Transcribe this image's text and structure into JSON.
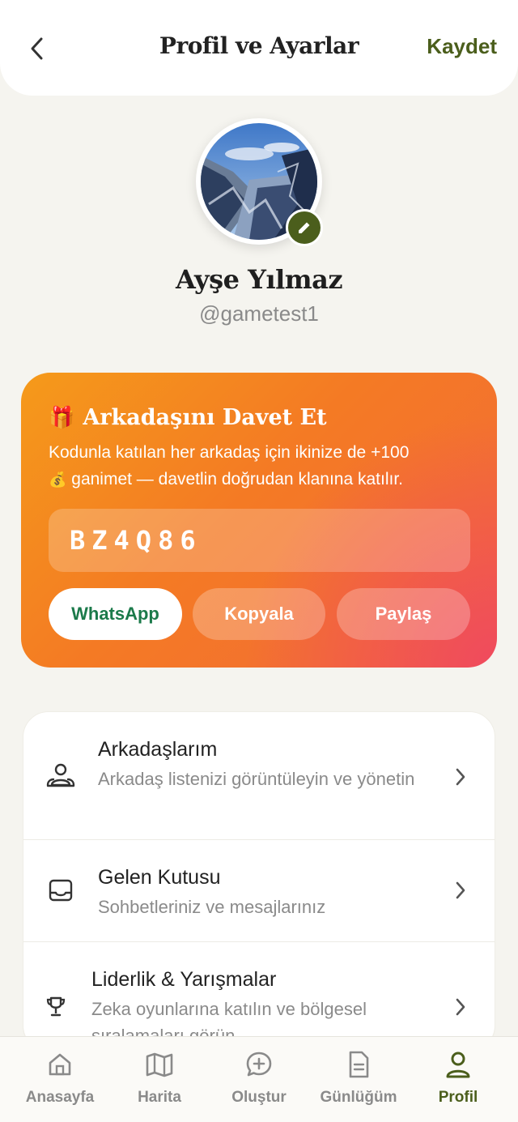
{
  "header": {
    "title": "Profil ve Ayarlar",
    "save_label": "Kaydet",
    "back_icon": "chevron-left-icon"
  },
  "profile": {
    "name": "Ayşe Yılmaz",
    "handle": "@gametest1",
    "edit_icon": "pencil-icon"
  },
  "invite": {
    "gift_icon": "🎁",
    "title": "Arkadaşını Davet Et",
    "description_line1": "Kodunla katılan her arkadaş için ikinize de +100",
    "moneybag_icon": "💰",
    "description_line2": "ganimet — davetlin doğrudan klanına katılır.",
    "code": "BZ4Q86",
    "whatsapp_label": "WhatsApp",
    "copy_label": "Kopyala",
    "share_label": "Paylaş"
  },
  "menu": {
    "items": [
      {
        "title": "Arkadaşlarım",
        "subtitle": "Arkadaş listenizi görüntüleyin ve yönetin",
        "icon": "friends-icon"
      },
      {
        "title": "Gelen Kutusu",
        "subtitle": "Sohbetleriniz ve mesajlarınız",
        "icon": "inbox-icon"
      },
      {
        "title": "Liderlik & Yarışmalar",
        "subtitle": "Zeka oyunlarına katılın ve bölgesel sıralamaları görün",
        "icon": "trophy-icon"
      }
    ]
  },
  "nav": {
    "items": [
      {
        "label": "Anasayfa",
        "icon": "home-icon"
      },
      {
        "label": "Harita",
        "icon": "map-icon"
      },
      {
        "label": "Oluştur",
        "icon": "create-icon"
      },
      {
        "label": "Günlüğüm",
        "icon": "journal-icon"
      },
      {
        "label": "Profil",
        "icon": "profile-icon"
      }
    ],
    "active": "Profil"
  },
  "colors": {
    "brand_green": "#4b5e1c",
    "background": "#f5f4ef",
    "invite_gradient_start": "#f59a1a",
    "invite_gradient_end": "#f04a5e",
    "whatsapp_text": "#1b7a4a"
  }
}
